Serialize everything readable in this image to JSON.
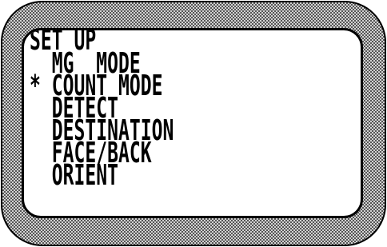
{
  "screen": {
    "title": "SET UP",
    "cursor_symbol": "*",
    "items": [
      {
        "label": "MG  MODE",
        "selected": false
      },
      {
        "label": "COUNT MODE",
        "selected": true
      },
      {
        "label": "DETECT",
        "selected": false
      },
      {
        "label": "DESTINATION",
        "selected": false
      },
      {
        "label": "FACE/BACK",
        "selected": false
      },
      {
        "label": "ORIENT",
        "selected": false
      }
    ]
  },
  "colors": {
    "text": "#000000",
    "screen_background": "#ffffff",
    "bezel_dark": "#555555",
    "bezel_light": "#d2d2d2"
  }
}
